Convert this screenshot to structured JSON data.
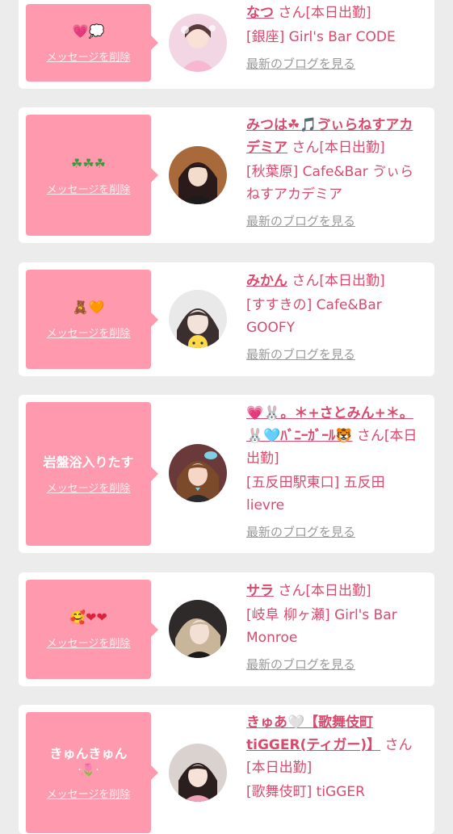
{
  "accent": "#ff99ad",
  "text_accent": "#d84a6e",
  "common": {
    "san_suffix": "さん[本日出勤]",
    "delete_label": "メッセージを削除",
    "blog_label": "最新のブログを見る"
  },
  "entries": [
    {
      "message": "💗💭",
      "name": "なつ",
      "shop": "[銀座] Girl's Bar CODE"
    },
    {
      "message": "☘☘☘",
      "name": "みつは☘🎵ゔぃらねすアカデミア",
      "shop": "[秋葉原] Cafe&Bar ゔぃらねすアカデミア"
    },
    {
      "message": "🧸🧡",
      "name": "みかん",
      "shop": "[すすきの] Cafe&Bar GOOFY"
    },
    {
      "message": "岩盤浴入りたす",
      "name": "💗🐰。＊+さとみん+＊。🐰🩵ﾊﾞﾆｰｶﾞｰﾙ🐯",
      "shop": "[五反田駅東口] 五反田 lievre"
    },
    {
      "message": "🥰❤❤",
      "name": "サラ",
      "shop": "[岐阜 柳ヶ瀬] Girl's Bar Monroe"
    },
    {
      "message": "きゅんきゅん",
      "message_sub": "·🌷·",
      "name": "きゅあ🤍【歌舞伎町tiGGER(ティガー)】",
      "shop": "[歌舞伎町] tiGGER"
    }
  ]
}
